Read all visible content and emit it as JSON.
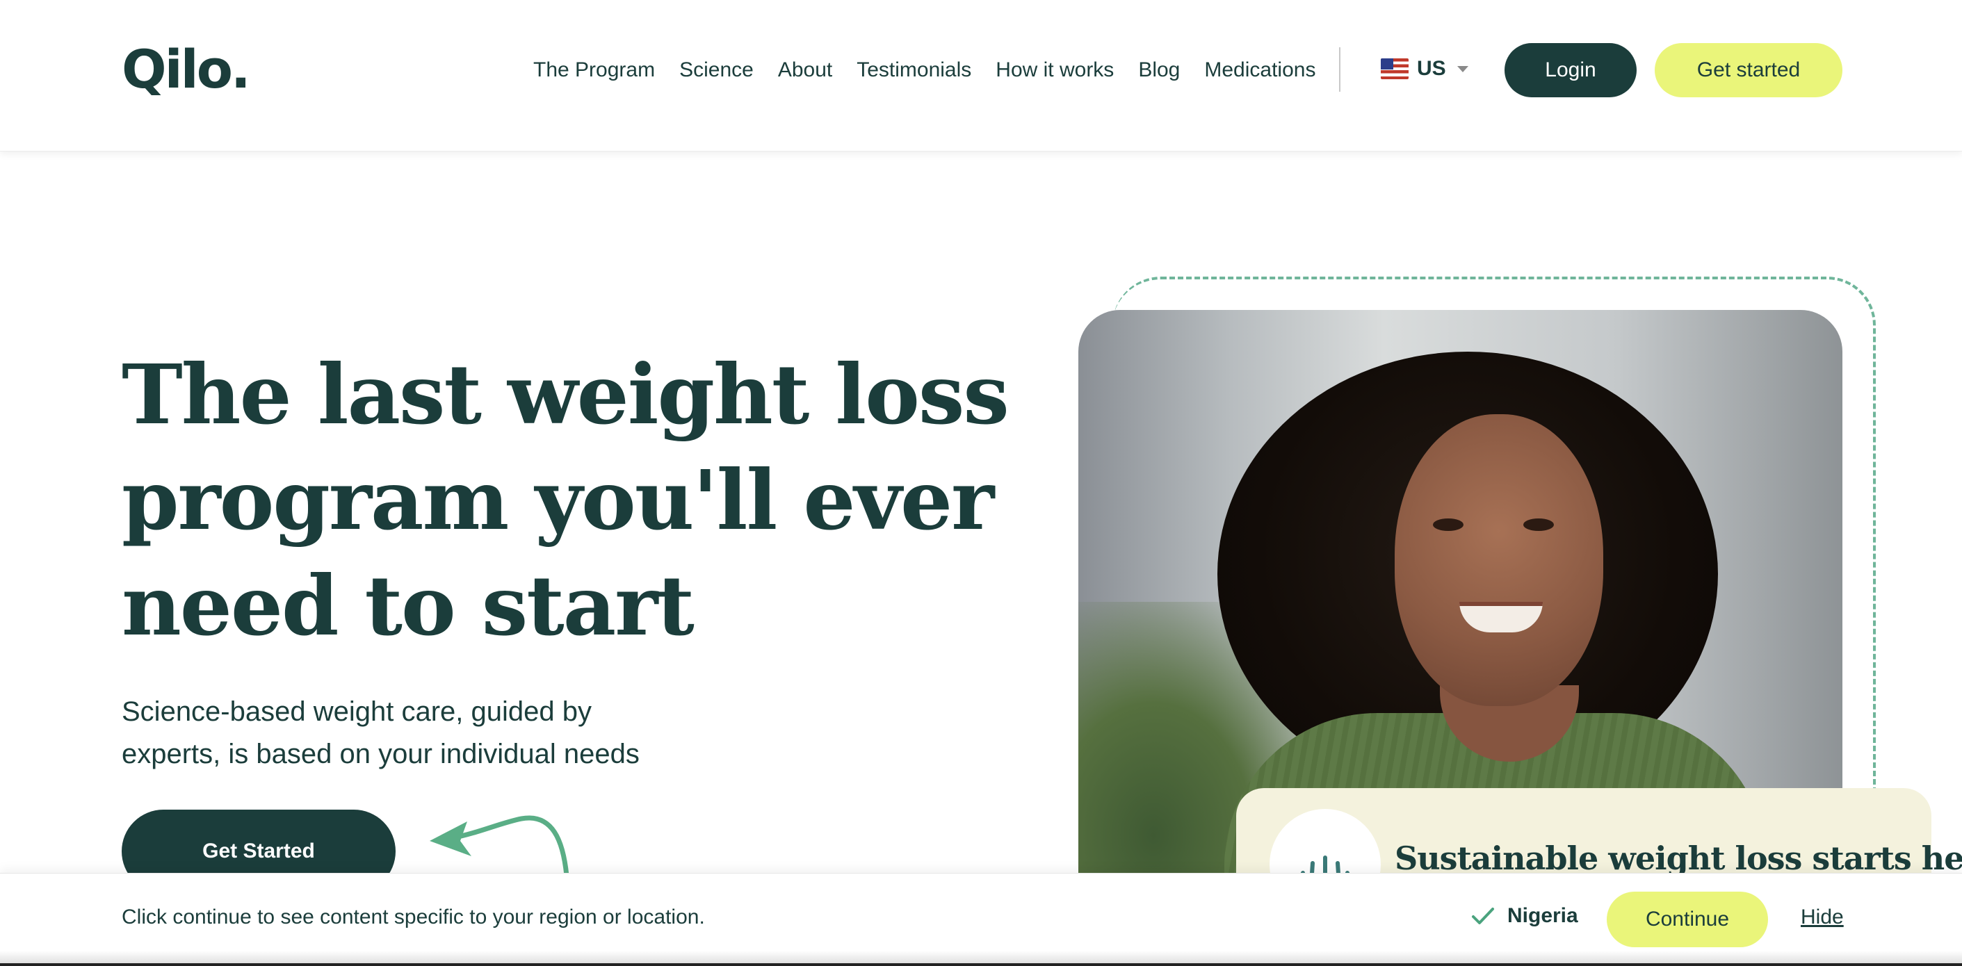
{
  "header": {
    "logo": "Qilo.",
    "nav": [
      {
        "label": "The Program"
      },
      {
        "label": "Science"
      },
      {
        "label": "About"
      },
      {
        "label": "Testimonials"
      },
      {
        "label": "How it works"
      },
      {
        "label": "Blog"
      },
      {
        "label": "Medications"
      }
    ],
    "locale": {
      "label": "US",
      "icon": "us-flag-icon"
    },
    "login_label": "Login",
    "get_started_label": "Get started"
  },
  "hero": {
    "headline": "The last weight loss program you'll ever need to start",
    "subtitle": "Science-based weight care, guided by experts, is based on your individual needs",
    "cta_label": "Get Started"
  },
  "card": {
    "text": "Sustainable weight loss starts here",
    "icon": "sprout-icon"
  },
  "region_bar": {
    "message": "Click continue to see content specific to your region or location.",
    "country": "Nigeria",
    "continue_label": "Continue",
    "hide_label": "Hide"
  },
  "colors": {
    "primary": "#1b3d3b",
    "accent": "#eaf57a",
    "dashed_border": "#6fb59a",
    "card_bg": "#f4f2dd"
  }
}
